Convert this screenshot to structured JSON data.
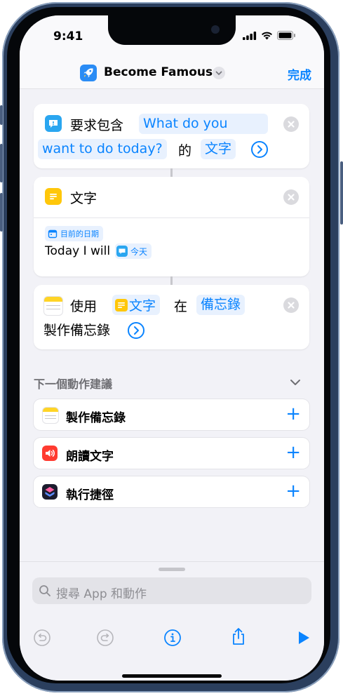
{
  "status": {
    "time": "9:41"
  },
  "header": {
    "app_title": "Become Famous",
    "done_label": "完成"
  },
  "actions": [
    {
      "parts": [
        "要求包含",
        "What do you",
        "want to do today?",
        "的",
        "文字"
      ]
    },
    {
      "title": "文字",
      "date_label": "目前的日期",
      "body_text": "Today I will",
      "token": "今天"
    },
    {
      "parts": [
        "使用",
        "文字",
        "在",
        "備忘錄",
        "製作備忘錄"
      ]
    }
  ],
  "suggestions": {
    "header": "下一個動作建議",
    "items": [
      {
        "label": "製作備忘錄",
        "icon": "notes-icon"
      },
      {
        "label": "朗讀文字",
        "icon": "speaker-icon",
        "color": "#ff3b30"
      },
      {
        "label": "執行捷徑",
        "icon": "shortcuts-icon"
      }
    ]
  },
  "search": {
    "placeholder": "搜尋 App 和動作"
  },
  "colors": {
    "accent": "#0a84ff",
    "frame": "#2b3f5e"
  }
}
